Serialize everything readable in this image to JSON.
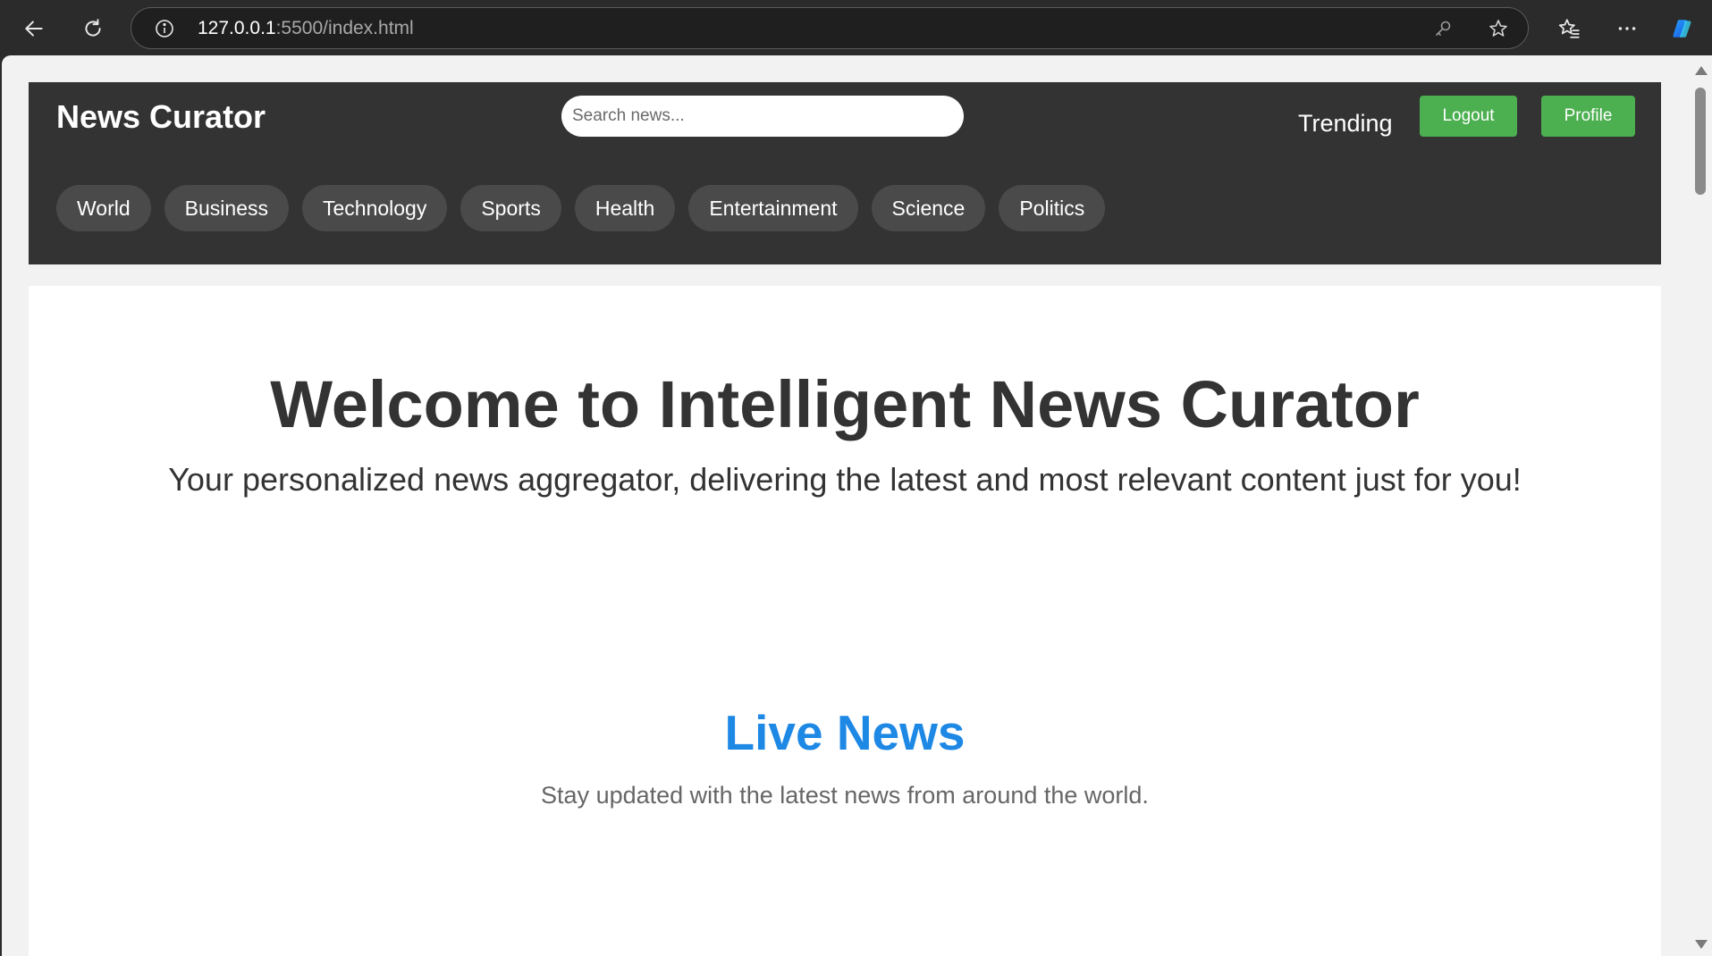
{
  "browser": {
    "url_host": "127.0.0.1",
    "url_path": ":5500/index.html"
  },
  "header": {
    "logo": "News Curator",
    "search_placeholder": "Search news...",
    "trending_label": "Trending",
    "logout_label": "Logout",
    "profile_label": "Profile",
    "categories": [
      "World",
      "Business",
      "Technology",
      "Sports",
      "Health",
      "Entertainment",
      "Science",
      "Politics"
    ]
  },
  "hero": {
    "title": "Welcome to Intelligent News Curator",
    "subtitle": "Your personalized news aggregator, delivering the latest and most relevant content just for you!"
  },
  "live": {
    "title": "Live News",
    "subtitle": "Stay updated with the latest news from around the world."
  },
  "colors": {
    "header_bg": "#333333",
    "button_green": "#4caf50",
    "live_title_blue": "#1e88e5"
  },
  "icons": {
    "back": "back-arrow-icon",
    "reload": "reload-icon",
    "site_info": "info-icon",
    "key": "key-icon",
    "favorite": "star-icon",
    "favorites_list": "favorites-icon",
    "more": "more-icon",
    "copilot": "copilot-icon"
  }
}
